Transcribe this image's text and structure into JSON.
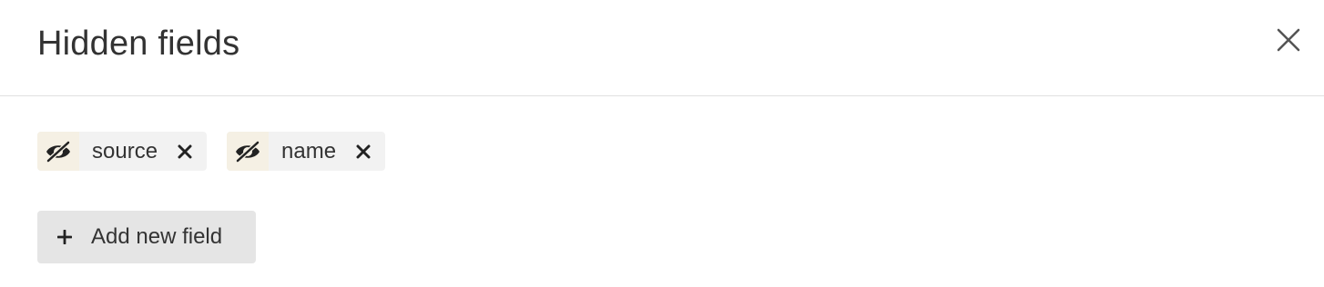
{
  "dialog": {
    "title": "Hidden fields",
    "close_icon": "close-icon"
  },
  "hidden_fields": [
    {
      "label": "source",
      "icon": "eye-slash-icon",
      "remove_icon": "remove-icon"
    },
    {
      "label": "name",
      "icon": "eye-slash-icon",
      "remove_icon": "remove-icon"
    }
  ],
  "add_button": {
    "icon": "plus-icon",
    "label": "Add new field"
  },
  "colors": {
    "text": "#333333",
    "chip_background": "#f2f2f2",
    "chip_icon_background": "#f5f0e4",
    "add_button_background": "#e5e5e5",
    "divider": "#e1e1e1",
    "close_icon": "#555555"
  }
}
